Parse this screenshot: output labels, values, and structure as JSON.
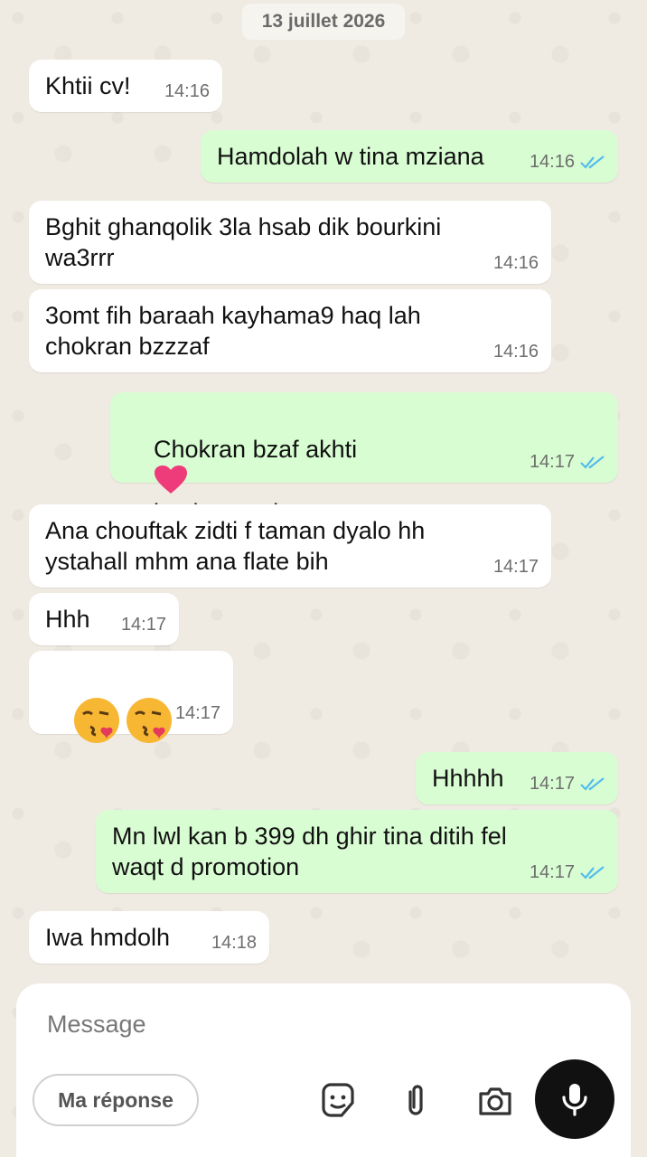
{
  "chat": {
    "date": "13 juillet 2026",
    "messages": [
      {
        "text": "Khtii cv!",
        "time": "14:16",
        "dir": "in"
      },
      {
        "text": "Hamdolah w tina mziana",
        "time": "14:16",
        "dir": "out"
      },
      {
        "text": "Bghit ghanqolik 3la hsab dik bourkini\nwa3rrr",
        "time": "14:16",
        "dir": "in"
      },
      {
        "text": "3omt fih baraah kayhama9 haq lah\nchokran bzzzaf",
        "time": "14:16",
        "dir": "in"
      },
      {
        "text_a": "Chokran bzaf akhti",
        "text_b": "bsaha w raha",
        "time": "14:17",
        "dir": "out"
      },
      {
        "text": "Ana chouftak zidti f taman dyalo hh\nystahall mhm ana flate bih",
        "time": "14:17",
        "dir": "in"
      },
      {
        "text": "Hhh",
        "time": "14:17",
        "dir": "in"
      },
      {
        "emoji": "face-blowing-kiss",
        "time": "14:17",
        "dir": "in"
      },
      {
        "text": "Hhhhh",
        "time": "14:17",
        "dir": "out"
      },
      {
        "text": "Mn lwl kan b 399 dh ghir tina ditih fel\nwaqt d promotion",
        "time": "14:17",
        "dir": "out"
      },
      {
        "text": "Iwa hmdolh",
        "time": "14:18",
        "dir": "in"
      }
    ]
  },
  "composer": {
    "placeholder": "Message",
    "reply_chip": "Ma réponse",
    "icons": [
      "sticker-icon",
      "attach-icon",
      "camera-icon",
      "mic-icon"
    ]
  },
  "colors": {
    "incoming": "#ffffff",
    "outgoing": "#d9fdd3",
    "read_ticks": "#53bdeb",
    "background": "#efeae2"
  }
}
